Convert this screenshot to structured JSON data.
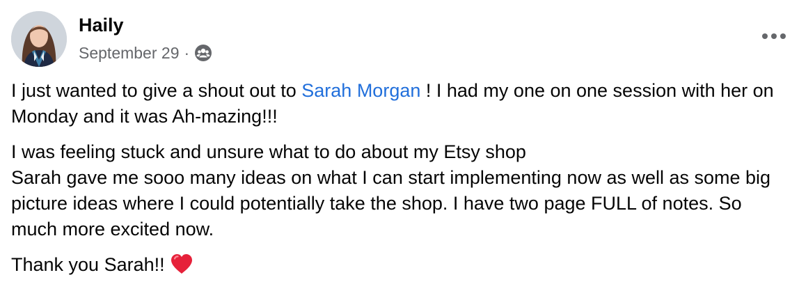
{
  "post": {
    "author": "Haily",
    "date": "September 29",
    "separator": "·",
    "audience_icon": "group-icon",
    "more_icon": "more-options-icon",
    "body": {
      "p1_before": "I just wanted to give a shout out to ",
      "mention": "Sarah Morgan",
      "p1_after": " ! I had my one on one session with her on Monday and it was Ah-mazing!!!",
      "p2_line1": "I was feeling stuck and unsure what to do about my Etsy shop",
      "p2_line2": "Sarah gave me sooo many ideas on what I can start implementing now as well as some big picture ideas where I could potentially take the shop. I have two page FULL of notes. So much more excited now.",
      "p3": "Thank you Sarah!!",
      "p3_emoji": "heart-icon"
    },
    "colors": {
      "mention": "#216fdb",
      "secondary_text": "#65676b",
      "heart": "#e6213a"
    }
  }
}
